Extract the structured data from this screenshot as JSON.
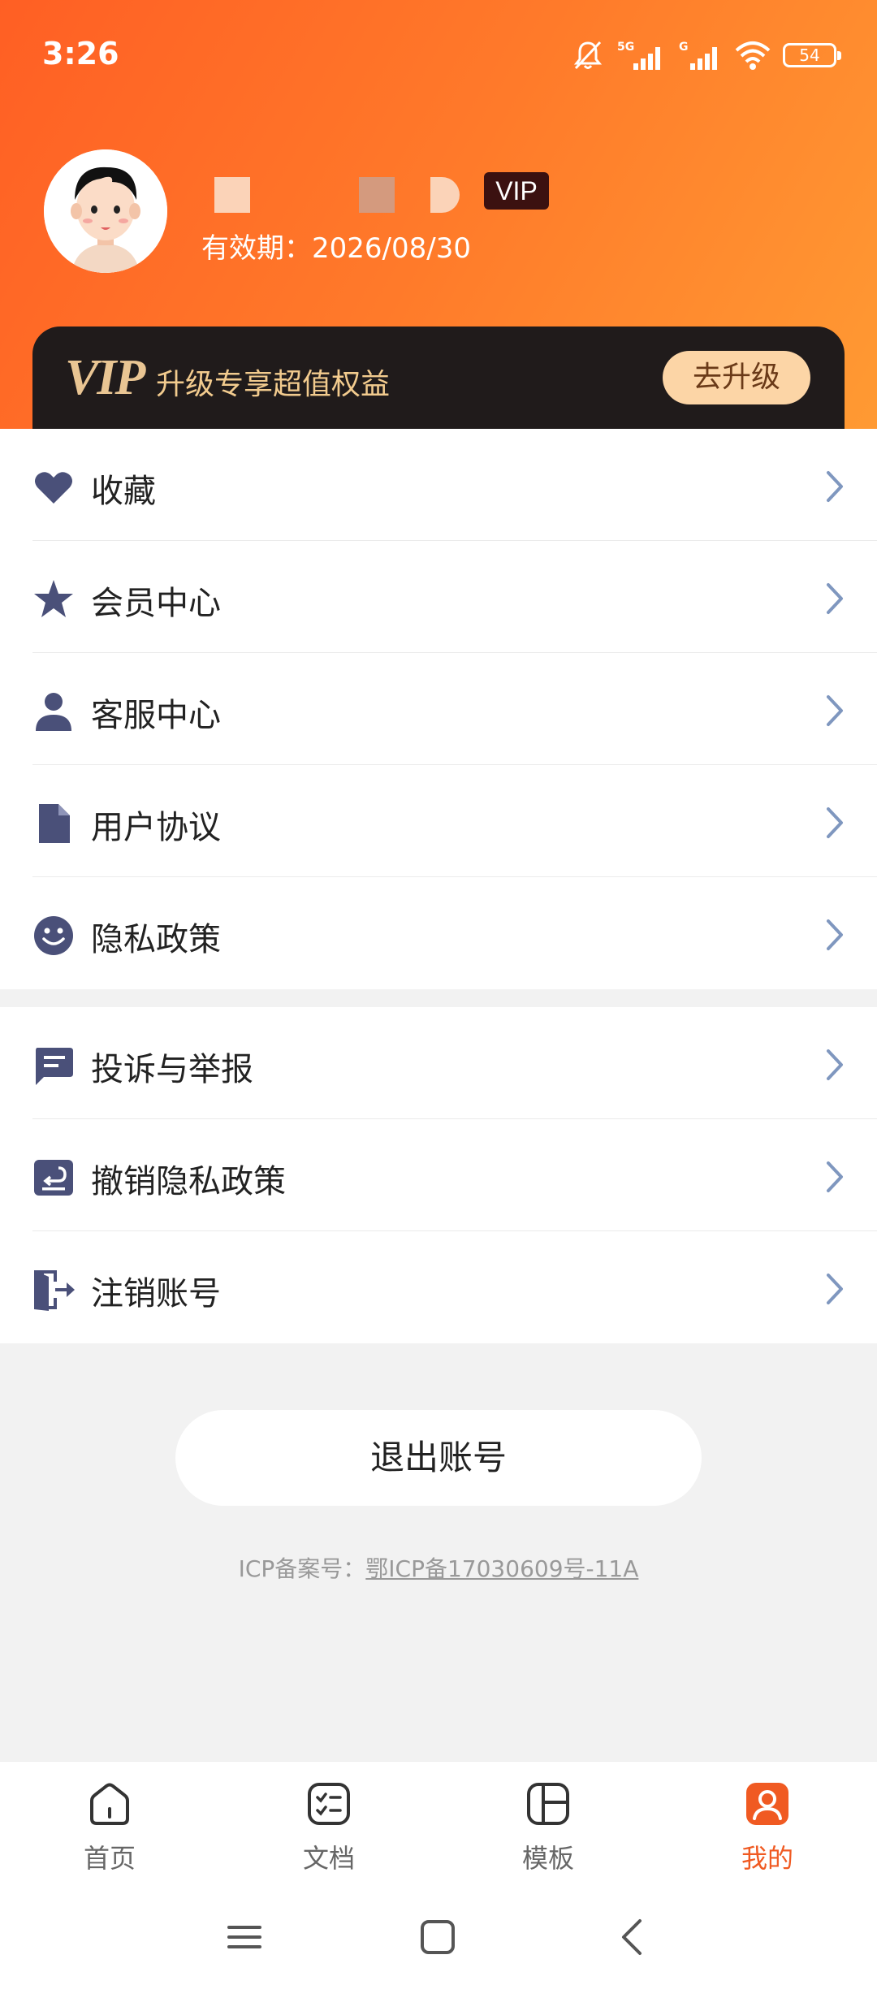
{
  "status_bar": {
    "time": "3:26",
    "network": "5G",
    "network2": "G",
    "battery": "54"
  },
  "profile": {
    "vip_badge": "VIP",
    "expiry": "有效期：2026/08/30"
  },
  "vip_banner": {
    "logo": "VIP",
    "promo": "升级专享超值权益",
    "upgrade_button": "去升级"
  },
  "menu_group_1": [
    {
      "label": "收藏",
      "icon": "heart-icon"
    },
    {
      "label": "会员中心",
      "icon": "star-icon"
    },
    {
      "label": "客服中心",
      "icon": "person-icon"
    },
    {
      "label": "用户协议",
      "icon": "document-icon"
    },
    {
      "label": "隐私政策",
      "icon": "smile-icon"
    }
  ],
  "menu_group_2": [
    {
      "label": "投诉与举报",
      "icon": "message-icon"
    },
    {
      "label": "撤销隐私政策",
      "icon": "revoke-icon"
    },
    {
      "label": "注销账号",
      "icon": "exit-icon"
    }
  ],
  "logout_button": "退出账号",
  "icp": {
    "prefix": "ICP备案号：",
    "number": "鄂ICP备17030609号-11A"
  },
  "bottom_nav": [
    {
      "label": "首页",
      "icon": "home-icon",
      "active": false
    },
    {
      "label": "文档",
      "icon": "checklist-icon",
      "active": false
    },
    {
      "label": "模板",
      "icon": "template-icon",
      "active": false
    },
    {
      "label": "我的",
      "icon": "profile-icon",
      "active": true
    }
  ],
  "colors": {
    "accent": "#f05a22",
    "header_gradient_start": "#ff5f24",
    "header_gradient_end": "#ff9a33",
    "icon_color": "#4a5079",
    "chevron_color": "#7f97bf",
    "vip_banner_bg": "#201b1b",
    "vip_gold": "#e9c593"
  }
}
